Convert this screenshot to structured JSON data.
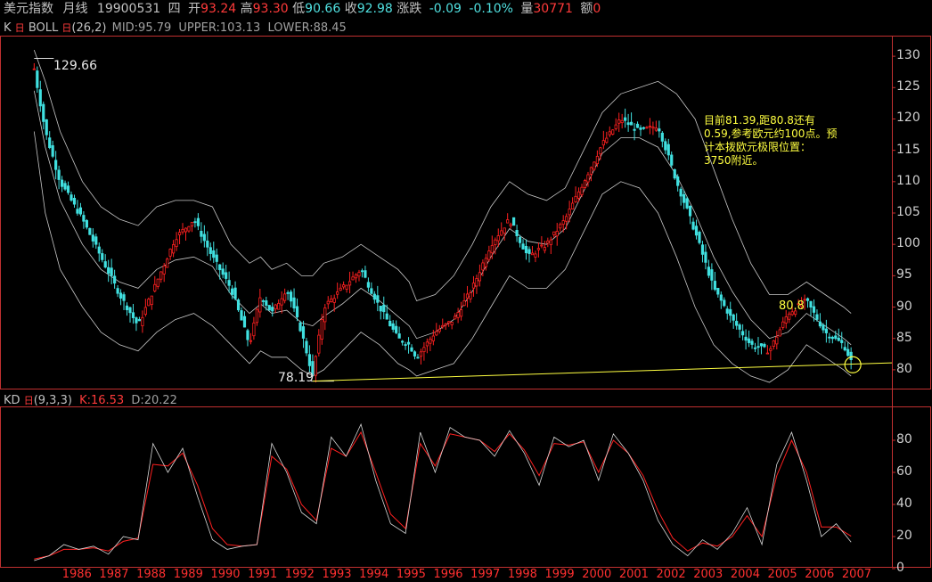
{
  "header": {
    "name": "美元指数",
    "period": "月线",
    "date": "19900531",
    "weekday": "四",
    "open_label": "开",
    "open": "93.24",
    "high_label": "高",
    "high": "93.30",
    "low_label": "低",
    "low": "90.66",
    "close_label": "收",
    "close": "92.98",
    "change_label": "涨跌",
    "change": "-0.09",
    "change_pct": "-0.10%",
    "vol_label": "量",
    "vol": "30771",
    "amount_label": "额",
    "amount": "0"
  },
  "indicator1": {
    "k_label": "K",
    "name": "BOLL",
    "params": "(26,2)",
    "mid": "MID:95.79",
    "upper": "UPPER:103.13",
    "lower": "LOWER:88.45"
  },
  "indicator2": {
    "name": "KD",
    "params": "(9,3,3)",
    "k": "K:16.53",
    "d": "D:20.22"
  },
  "price_labels": {
    "high": "129.66",
    "low": "78.19",
    "level": "80.8"
  },
  "annotation": "目前81.39,距80.8还有0.59,参考欧元约100点。预计本拨欧元极限位置：3750附近。",
  "colors": {
    "up": "#ff2020",
    "down": "#40e0e0",
    "band": "#c8c8c8",
    "k_line": "#d8d8d8",
    "d_line": "#ff2020",
    "trend": "#ffff40",
    "frame": "#c03030"
  },
  "chart_data": [
    {
      "type": "candlestick",
      "title": "美元指数 月线",
      "ylim": [
        77,
        133
      ],
      "yticks": [
        80,
        85,
        90,
        95,
        100,
        105,
        110,
        115,
        120,
        125,
        130
      ],
      "xticks": [
        "1986",
        "1987",
        "1988",
        "1989",
        "1990",
        "1991",
        "1992",
        "1993",
        "1994",
        "1995",
        "1996",
        "1997",
        "1998",
        "1999",
        "2000",
        "2001",
        "2002",
        "2003",
        "2004",
        "2005",
        "2006",
        "2007"
      ],
      "path_x": [
        1985.2,
        1985.5,
        1985.9,
        1986.5,
        1987.0,
        1987.5,
        1988.0,
        1988.5,
        1989.0,
        1989.5,
        1990.0,
        1990.5,
        1991.0,
        1991.3,
        1991.6,
        1992.0,
        1992.4,
        1992.7,
        1993.0,
        1993.5,
        1994.0,
        1994.5,
        1995.0,
        1995.3,
        1995.5,
        1996.0,
        1996.5,
        1997.0,
        1997.5,
        1998.0,
        1998.5,
        1999.0,
        1999.5,
        2000.0,
        2000.5,
        2001.0,
        2001.5,
        2002.0,
        2002.5,
        2003.0,
        2003.5,
        2004.0,
        2004.5,
        2005.0,
        2005.5,
        2006.0,
        2006.5,
        2007.0,
        2007.2
      ],
      "path_close": [
        128,
        118,
        110,
        104,
        98,
        92,
        87,
        94,
        101,
        104,
        98,
        93,
        84,
        92,
        89,
        93,
        86,
        79,
        90,
        93,
        96,
        90,
        85,
        84,
        82,
        86,
        88,
        93,
        100,
        104,
        98,
        100,
        104,
        110,
        116,
        120,
        118,
        119,
        110,
        102,
        93,
        88,
        84,
        83,
        89,
        91,
        86,
        84,
        81.4
      ],
      "markers": {
        "high": {
          "x": 1985.2,
          "y": 129.66
        },
        "low": {
          "x": 1992.7,
          "y": 78.19
        },
        "level": {
          "y": 80.8
        }
      },
      "upper_band": [
        131,
        126,
        118,
        110,
        106,
        104,
        103,
        106,
        107,
        107,
        106,
        100,
        97,
        98,
        96,
        97,
        95,
        95,
        97,
        98,
        100,
        98,
        96,
        94,
        91,
        92,
        95,
        100,
        106,
        110,
        108,
        107,
        109,
        115,
        121,
        124,
        125,
        126,
        124,
        120,
        112,
        104,
        97,
        92,
        92,
        94,
        92,
        90,
        89
      ],
      "lower_band": [
        118,
        105,
        96,
        90,
        86,
        84,
        83,
        86,
        88,
        89,
        87,
        84,
        81,
        83,
        82,
        82,
        80,
        79,
        80,
        83,
        86,
        84,
        81,
        80,
        79,
        80,
        81,
        85,
        90,
        95,
        93,
        93,
        96,
        102,
        108,
        110,
        109,
        105,
        98,
        90,
        84,
        81,
        79,
        78,
        80,
        84,
        82,
        80,
        79
      ],
      "trendline": [
        [
          1992.7,
          78.19
        ],
        [
          2007.9,
          81.0
        ]
      ]
    },
    {
      "type": "line",
      "title": "KD(9,3,3)",
      "ylim": [
        0,
        100
      ],
      "yticks": [
        0,
        20,
        40,
        60,
        80
      ],
      "x": [
        1985.2,
        1985.6,
        1986.0,
        1986.4,
        1986.8,
        1987.2,
        1987.6,
        1988.0,
        1988.4,
        1988.8,
        1989.2,
        1989.6,
        1990.0,
        1990.4,
        1990.8,
        1991.2,
        1991.6,
        1992.0,
        1992.4,
        1992.8,
        1993.2,
        1993.6,
        1994.0,
        1994.4,
        1994.8,
        1995.2,
        1995.6,
        1996.0,
        1996.4,
        1996.8,
        1997.2,
        1997.6,
        1998.0,
        1998.4,
        1998.8,
        1999.2,
        1999.6,
        2000.0,
        2000.4,
        2000.8,
        2001.2,
        2001.6,
        2002.0,
        2002.4,
        2002.8,
        2003.2,
        2003.6,
        2004.0,
        2004.4,
        2004.8,
        2005.2,
        2005.6,
        2006.0,
        2006.4,
        2006.8,
        2007.2
      ],
      "series": [
        {
          "name": "K",
          "values": [
            5,
            8,
            15,
            12,
            14,
            9,
            20,
            18,
            78,
            60,
            75,
            45,
            18,
            12,
            14,
            15,
            78,
            60,
            35,
            28,
            82,
            70,
            90,
            55,
            28,
            22,
            85,
            60,
            88,
            82,
            80,
            70,
            86,
            72,
            52,
            82,
            76,
            80,
            55,
            84,
            72,
            55,
            30,
            15,
            8,
            18,
            12,
            22,
            38,
            15,
            65,
            85,
            55,
            20,
            28,
            16.53
          ]
        },
        {
          "name": "D",
          "values": [
            6,
            8,
            12,
            12,
            13,
            11,
            17,
            19,
            65,
            64,
            72,
            52,
            25,
            15,
            14,
            15,
            70,
            62,
            40,
            30,
            75,
            70,
            85,
            60,
            34,
            25,
            78,
            64,
            84,
            82,
            80,
            73,
            84,
            74,
            58,
            78,
            77,
            79,
            60,
            80,
            72,
            58,
            36,
            19,
            11,
            16,
            14,
            20,
            33,
            20,
            58,
            80,
            60,
            26,
            26,
            20.22
          ]
        }
      ]
    }
  ]
}
